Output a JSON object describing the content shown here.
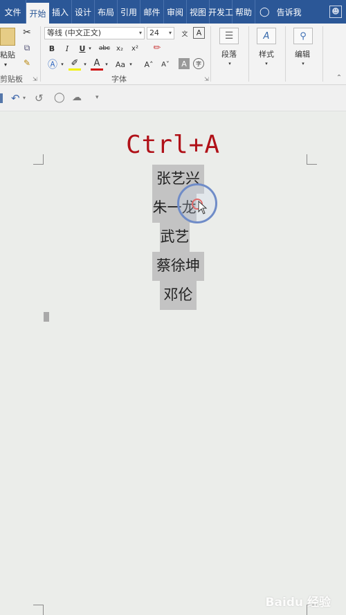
{
  "tabs": {
    "file": "文件",
    "home": "开始",
    "insert": "插入",
    "design": "设计",
    "layout": "布局",
    "references": "引用",
    "mailings": "邮件",
    "review": "审阅",
    "view": "视图",
    "developer": "开发工",
    "help": "帮助",
    "tell_me": "告诉我"
  },
  "ribbon": {
    "clipboard": {
      "paste_label": "粘贴",
      "group_label": "剪贴板"
    },
    "font": {
      "font_name": "等线 (中文正文)",
      "font_size": "24",
      "bold": "B",
      "italic": "I",
      "underline": "U",
      "strikethrough": "abc",
      "subscript": "x₂",
      "superscript": "x²",
      "font_color": "A",
      "change_case": "Aa",
      "grow_font": "A˄",
      "shrink_font": "A˅",
      "char_shading": "A",
      "wen": "文",
      "phonetic": "字",
      "group_label": "字体"
    },
    "paragraph_label": "段落",
    "styles_label": "样式",
    "editing_label": "编辑"
  },
  "document": {
    "heading": "Ctrl+A",
    "names": [
      "张艺兴",
      "朱一龙",
      "武艺",
      "蔡徐坤",
      "邓伦"
    ]
  },
  "watermark": "Baidu 经验",
  "colors": {
    "tab_bar": "#2b5797",
    "heading": "#b01118",
    "selection": "#c3c3c3",
    "page": "#ebedea"
  }
}
